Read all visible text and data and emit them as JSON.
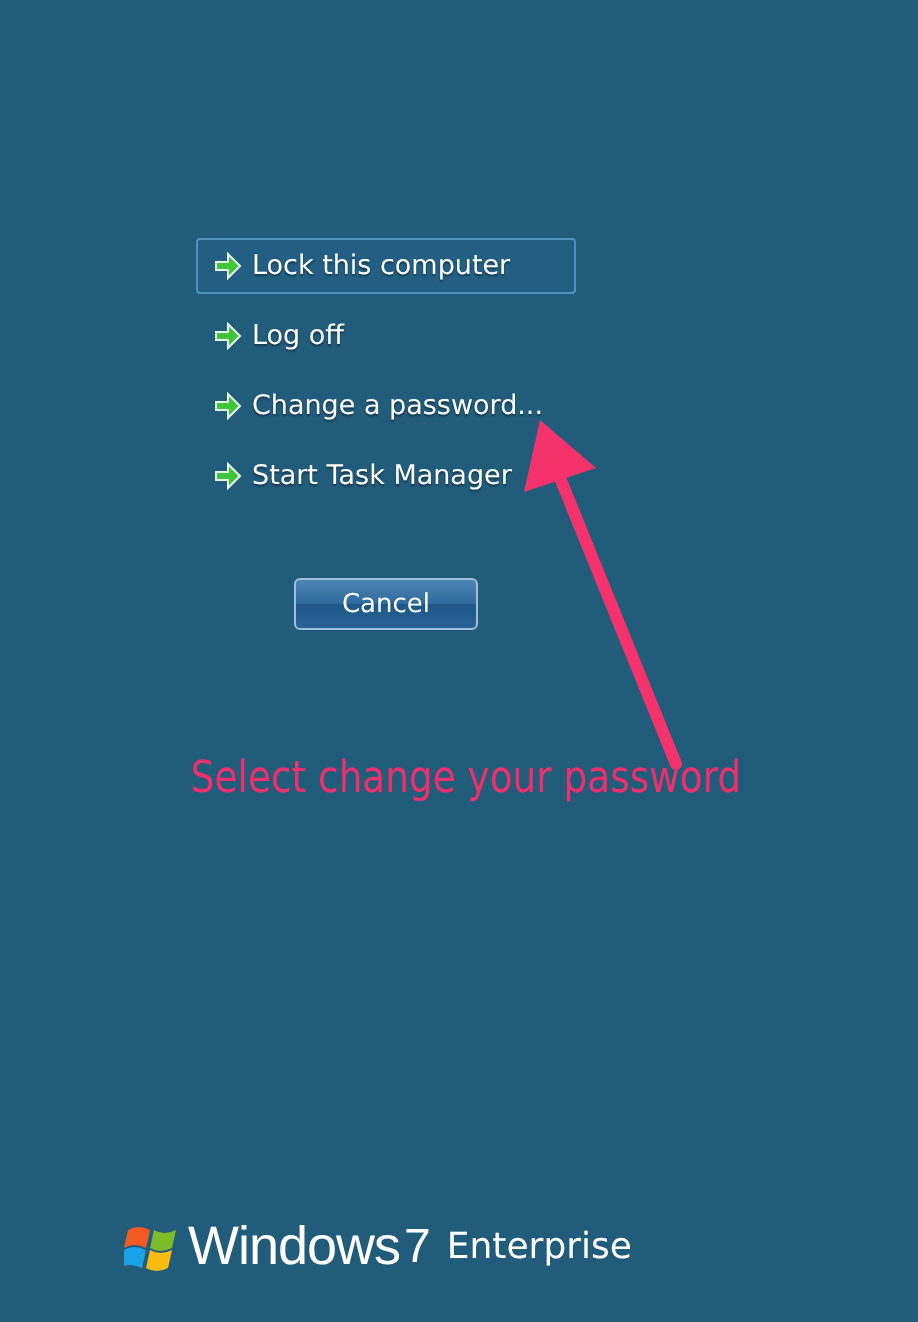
{
  "options": [
    {
      "label": "Lock this computer",
      "selected": true
    },
    {
      "label": "Log off",
      "selected": false
    },
    {
      "label": "Change a password...",
      "selected": false
    },
    {
      "label": "Start Task Manager",
      "selected": false
    }
  ],
  "cancel_button": "Cancel",
  "annotation": {
    "text": "Select change your password"
  },
  "logo": {
    "name": "Windows",
    "version": "7",
    "edition": "Enterprise"
  }
}
